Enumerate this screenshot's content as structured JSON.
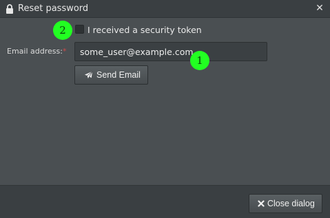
{
  "dialog": {
    "title": "Reset password",
    "close_glyph": "✕",
    "title_icon": "lock-icon",
    "close_icon": "close-icon"
  },
  "form": {
    "token_checkbox": {
      "label": "I received a security token",
      "checked": false
    },
    "email": {
      "label": "Email address:",
      "required_mark": "*",
      "value": "some_user@example.com",
      "placeholder": ""
    },
    "send_button": {
      "label": "Send Email",
      "icon": "paper-plane-icon"
    }
  },
  "footer": {
    "close_button": {
      "label": "Close dialog",
      "icon": "close-icon"
    }
  },
  "markers": [
    {
      "label": "1"
    },
    {
      "label": "2"
    }
  ],
  "colors": {
    "marker": "#22ff22",
    "required": "#d24a4a",
    "background": "#4a4f52",
    "titlebar": "#3a3f42"
  }
}
